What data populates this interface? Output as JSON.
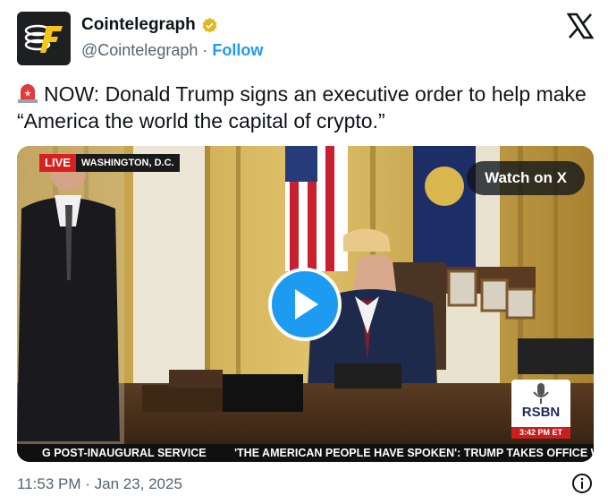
{
  "author": {
    "name": "Cointelegraph",
    "handle": "@Cointelegraph",
    "separator": "·",
    "follow_label": "Follow"
  },
  "tweet": {
    "text": "NOW: Donald Trump signs an executive order to help make “America the world the capital of crypto.”",
    "timestamp": "11:53 PM · Jan 23, 2025"
  },
  "media": {
    "watch_label": "Watch on X",
    "live_label": "LIVE",
    "location_label": "WASHINGTON, D.C.",
    "ticker_left": "G POST-INAUGURAL SERVICE",
    "ticker_right": "'THE AMERICAN PEOPLE HAVE SPOKEN': TRUMP TAKES OFFICE W",
    "network_logo": "RSBN",
    "network_time": "3:42 PM ET"
  },
  "icons": {
    "verified": "verified-badge-icon",
    "platform": "x-logo-icon",
    "siren": "siren-emoji-icon",
    "play": "play-icon",
    "info": "info-icon"
  },
  "colors": {
    "accent": "#1d9bf0",
    "verified": "#e2b719",
    "live_red": "#d92020",
    "muted_text": "#536471"
  }
}
